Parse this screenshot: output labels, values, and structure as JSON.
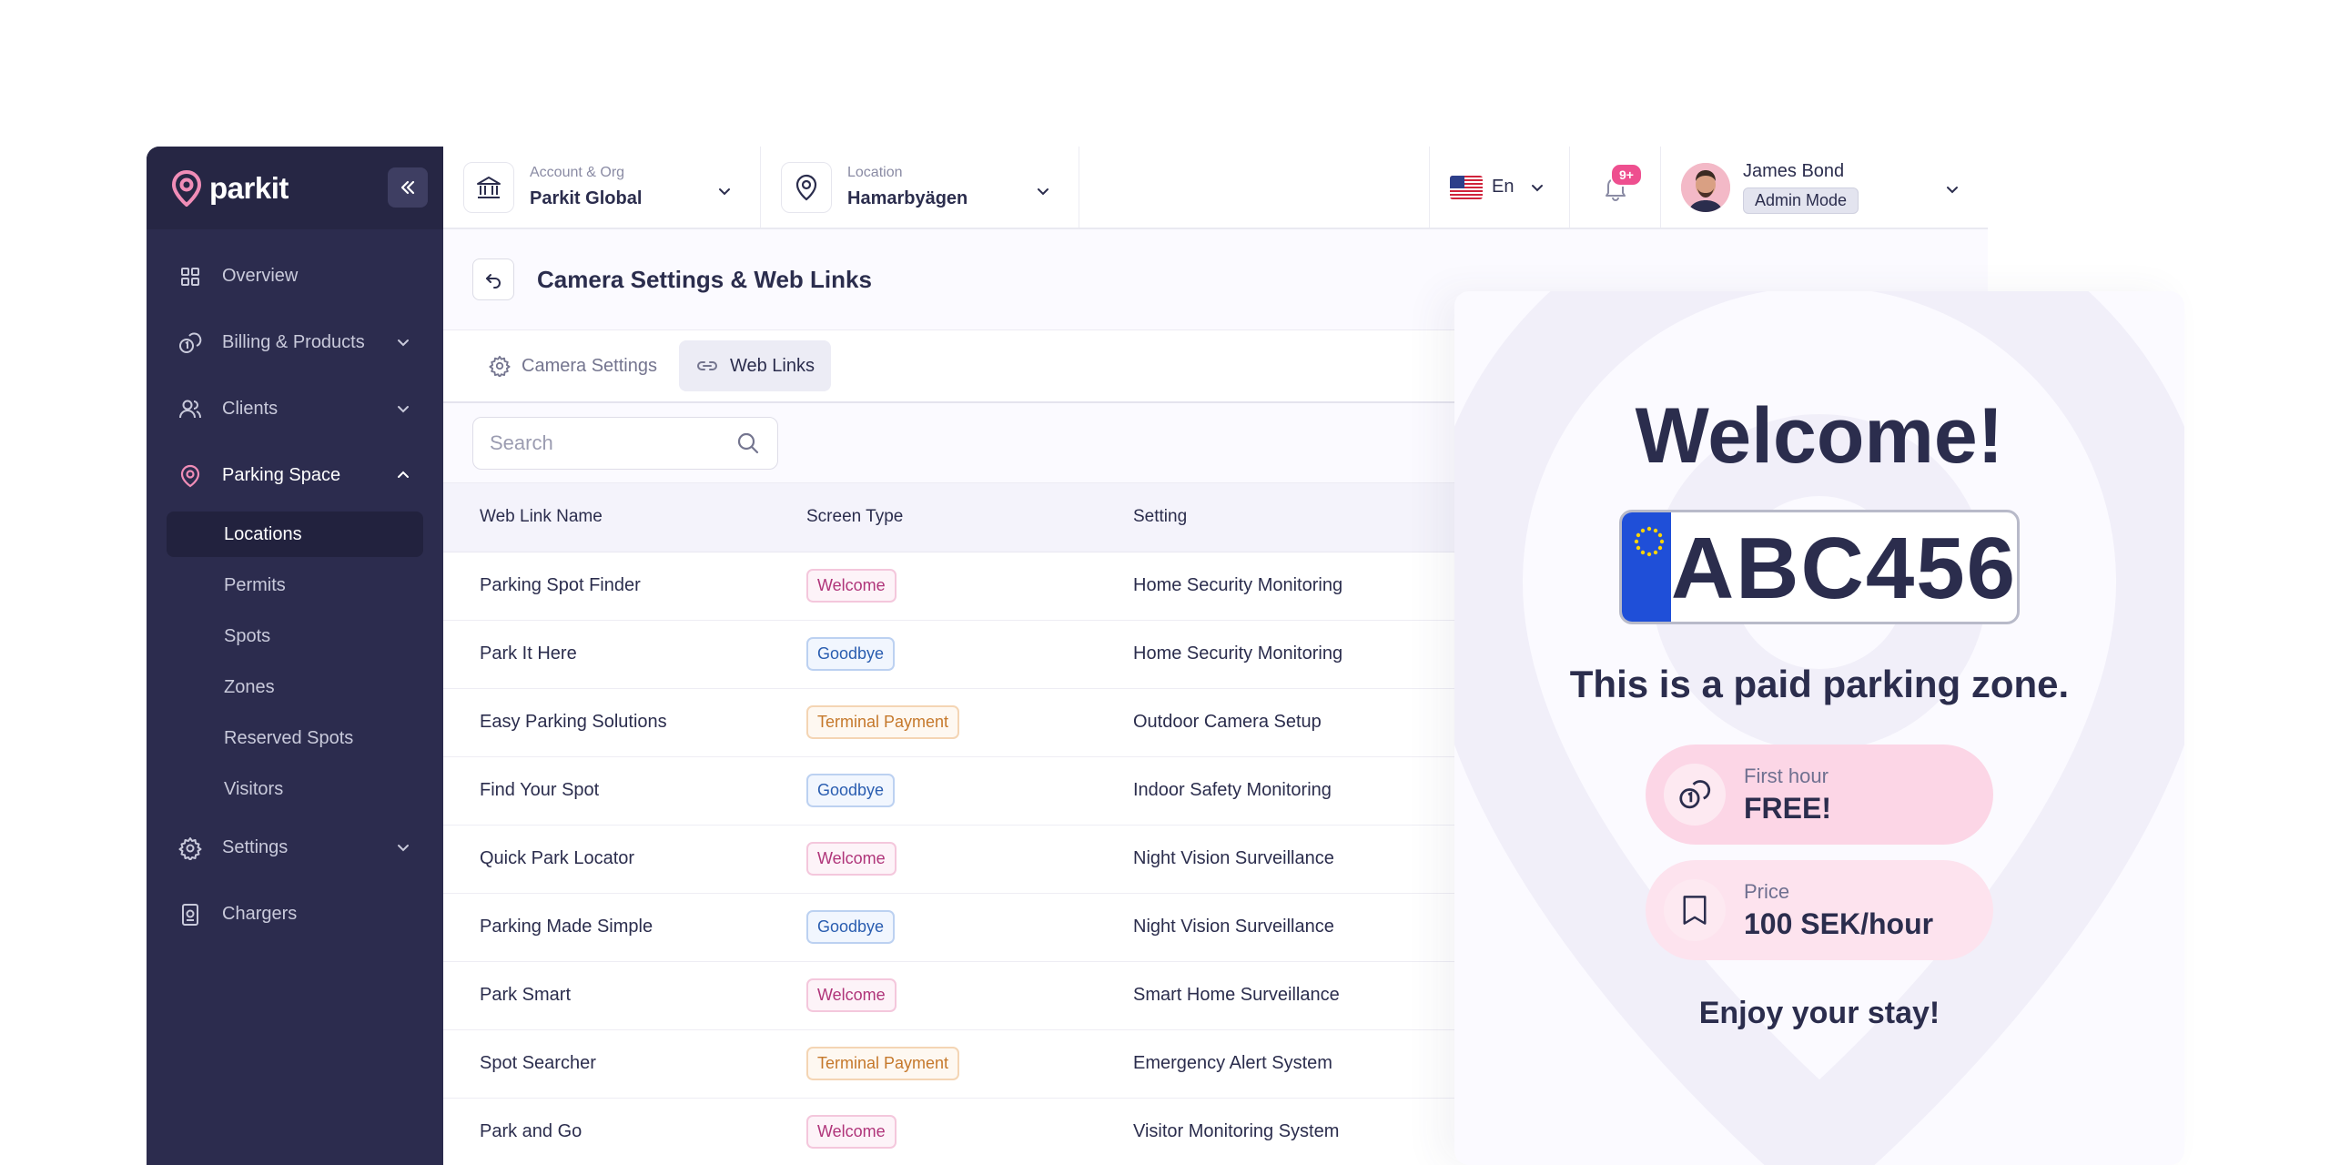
{
  "brand": {
    "name": "parkit"
  },
  "sidebar": {
    "items": [
      {
        "label": "Overview",
        "icon": "grid-icon"
      },
      {
        "label": "Billing & Products",
        "icon": "coins-icon"
      },
      {
        "label": "Clients",
        "icon": "users-icon"
      },
      {
        "label": "Parking Space",
        "icon": "location-pin-icon"
      },
      {
        "label": "Settings",
        "icon": "gear-icon"
      },
      {
        "label": "Chargers",
        "icon": "charger-icon"
      }
    ],
    "parking_space_children": [
      "Locations",
      "Permits",
      "Spots",
      "Zones",
      "Reserved Spots",
      "Visitors"
    ],
    "selected_child": "Locations"
  },
  "topbar": {
    "account_label": "Account & Org",
    "account_value": "Parkit Global",
    "location_label": "Location",
    "location_value": "Hamarbyägen",
    "language": "En",
    "notification_count": "9+",
    "user_name": "James Bond",
    "user_role": "Admin Mode"
  },
  "page": {
    "title": "Camera Settings & Web Links",
    "tabs": [
      {
        "label": "Camera Settings",
        "active": false
      },
      {
        "label": "Web Links",
        "active": true
      }
    ],
    "search_placeholder": "Search"
  },
  "table": {
    "headers": [
      "Web Link Name",
      "Screen Type",
      "Setting"
    ],
    "rows": [
      {
        "name": "Parking Spot Finder",
        "type": "Welcome",
        "setting": "Home Security Monitoring"
      },
      {
        "name": "Park It Here",
        "type": "Goodbye",
        "setting": "Home Security Monitoring"
      },
      {
        "name": "Easy Parking Solutions",
        "type": "Terminal Payment",
        "setting": "Outdoor Camera Setup"
      },
      {
        "name": "Find Your Spot",
        "type": "Goodbye",
        "setting": "Indoor Safety Monitoring"
      },
      {
        "name": "Quick Park Locator",
        "type": "Welcome",
        "setting": "Night Vision Surveillance"
      },
      {
        "name": "Parking Made Simple",
        "type": "Goodbye",
        "setting": "Night Vision Surveillance"
      },
      {
        "name": "Park Smart",
        "type": "Welcome",
        "setting": "Smart Home Surveillance"
      },
      {
        "name": "Spot Searcher",
        "type": "Terminal Payment",
        "setting": "Emergency Alert System"
      },
      {
        "name": "Park and Go",
        "type": "Welcome",
        "setting": "Visitor Monitoring System"
      }
    ]
  },
  "preview": {
    "title": "Welcome!",
    "plate": "ABC456",
    "subtitle": "This is a paid parking zone.",
    "first_hour_label": "First hour",
    "first_hour_value": "FREE!",
    "price_label": "Price",
    "price_value": "100 SEK/hour",
    "footer": "Enjoy your stay!"
  },
  "colors": {
    "sidebar_bg": "#2c2c4e",
    "accent_pink": "#ee4f8f",
    "welcome": "#b0357a",
    "goodbye": "#2a5db0",
    "terminal": "#c5782b",
    "plate_eu_blue": "#1f4fd8"
  }
}
